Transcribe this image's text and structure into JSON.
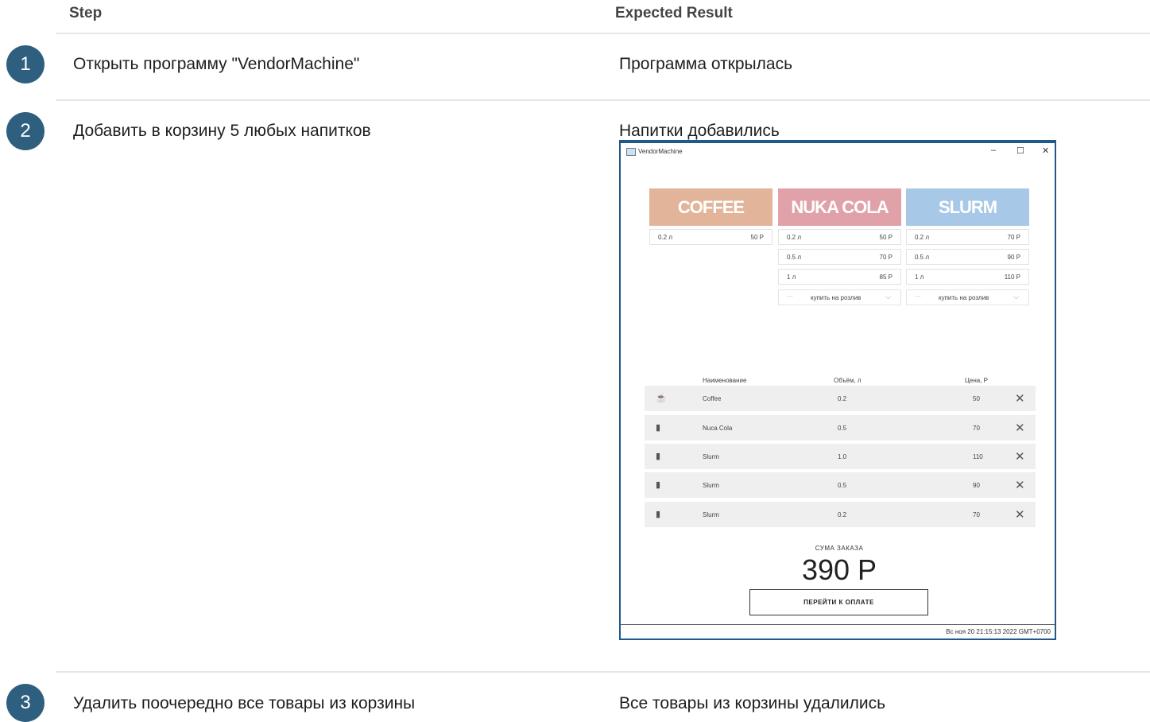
{
  "header": {
    "step": "Step",
    "expected": "Expected Result"
  },
  "steps": [
    {
      "num": "1",
      "step": "Открыть программу \"VendorMachine\"",
      "expected": "Программа открылась"
    },
    {
      "num": "2",
      "step": "Добавить в корзину 5 любых напитков",
      "expected": "Напитки добавились"
    },
    {
      "num": "3",
      "step": "Удалить поочередно все товары из корзины",
      "expected": "Все товары из корзины удалились"
    }
  ],
  "app": {
    "title": "VendorMachine",
    "window_buttons": {
      "minimize": "–",
      "maximize": "☐",
      "close": "✕"
    },
    "products": [
      {
        "name": "COFFEE",
        "color": "#e2b49a",
        "sizes": [
          {
            "vol": "0.2 л",
            "price": "50 Р"
          }
        ]
      },
      {
        "name": "NUKA COLA",
        "color": "#e0a2a8",
        "sizes": [
          {
            "vol": "0.2 л",
            "price": "50 Р"
          },
          {
            "vol": "0.5 л",
            "price": "70 Р"
          },
          {
            "vol": "1 л",
            "price": "85 Р"
          }
        ],
        "draft": "купить на розлив"
      },
      {
        "name": "SLURM",
        "color": "#a7c8e6",
        "sizes": [
          {
            "vol": "0.2 л",
            "price": "70 Р"
          },
          {
            "vol": "0.5 л",
            "price": "90 Р"
          },
          {
            "vol": "1 л",
            "price": "110 Р"
          }
        ],
        "draft": "купить на розлив"
      }
    ],
    "cart_headers": {
      "name": "Наименование",
      "volume": "Объём, л",
      "price": "Цена, Р"
    },
    "cart": [
      {
        "icon": "coffee-cup-icon",
        "name": "Coffee",
        "volume": "0.2",
        "price": "50"
      },
      {
        "icon": "bottle-icon",
        "name": "Nuca Cola",
        "volume": "0.5",
        "price": "70"
      },
      {
        "icon": "can-icon",
        "name": "Slurm",
        "volume": "1.0",
        "price": "110"
      },
      {
        "icon": "can-icon",
        "name": "Slurm",
        "volume": "0.5",
        "price": "90"
      },
      {
        "icon": "can-icon",
        "name": "Slurm",
        "volume": "0.2",
        "price": "70"
      }
    ],
    "sum_label": "СУМА ЗАКАЗА",
    "sum_value": "390 Р",
    "pay_button": "ПЕРЕЙТИ К ОПЛАТЕ",
    "status": "Вс ноя 20 21:15:13 2022 GMT+0700"
  }
}
